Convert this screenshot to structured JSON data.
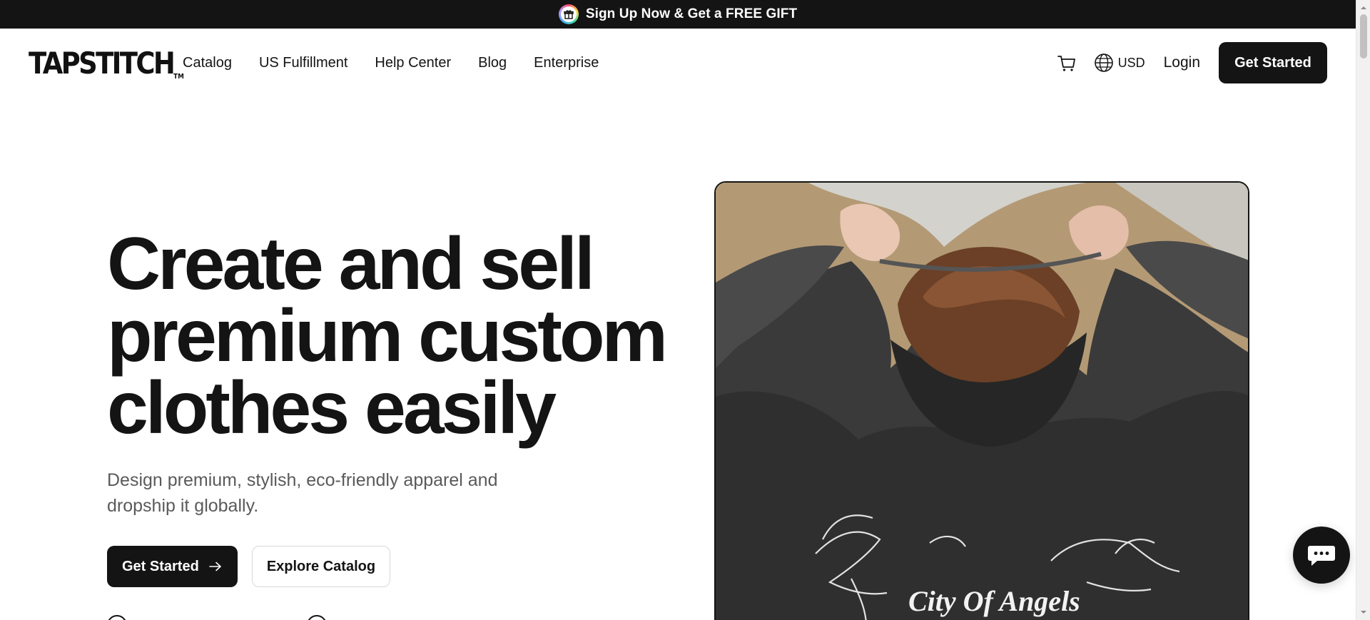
{
  "promo": {
    "text": "Sign Up Now & Get a FREE GIFT",
    "icon": "gift-icon"
  },
  "nav": {
    "logo": "TAPSTITCH",
    "logo_tm": "TM",
    "links": [
      "Catalog",
      "US Fulfillment",
      "Help Center",
      "Blog",
      "Enterprise"
    ],
    "currency": "USD",
    "login": "Login",
    "cta": "Get Started"
  },
  "hero": {
    "title_lines": [
      "Create and sell",
      "premium custom",
      "clothes easily"
    ],
    "subtitle": "Design premium, stylish, eco-friendly apparel and dropship it globally.",
    "primary_cta": "Get Started",
    "secondary_cta": "Explore Catalog",
    "image_print_text": "City Of Angels"
  },
  "colors": {
    "primary": "#141414",
    "background": "#ffffff",
    "subtitle": "#5a5a5a",
    "photo_backdrop": "#b39a75",
    "sweatshirt": "#3a3a3a"
  },
  "icons": [
    "gift-icon",
    "cart-icon",
    "globe-icon",
    "arrow-right-icon",
    "chat-bubble-icon"
  ]
}
